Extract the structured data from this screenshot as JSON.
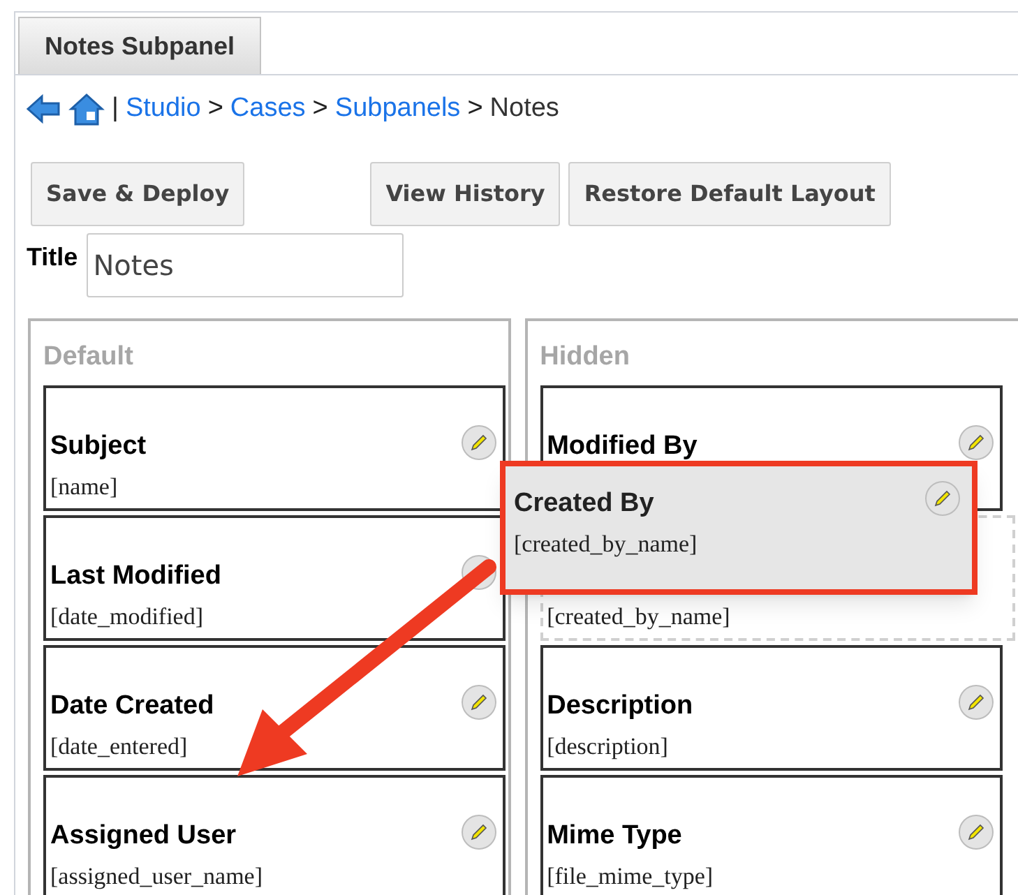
{
  "tab": {
    "label": "Notes Subpanel",
    "selected": true
  },
  "breadcrumb": {
    "pipe": "|",
    "separator": ">",
    "items": [
      {
        "text": "Studio",
        "kind": "link"
      },
      {
        "text": "Cases",
        "kind": "link"
      },
      {
        "text": "Subpanels",
        "kind": "link"
      },
      {
        "text": "Notes",
        "kind": "current"
      }
    ]
  },
  "buttons": [
    "Save & Deploy",
    "View History",
    "Restore Default Layout"
  ],
  "title_field": {
    "label": "Title",
    "value": "Notes"
  },
  "columns": [
    {
      "heading": "Default",
      "cards": [
        {
          "label": "Subject",
          "field": "[name]",
          "kind": "field"
        },
        {
          "label": "Last Modified",
          "field": "[date_modified]",
          "kind": "field"
        },
        {
          "label": "Date Created",
          "field": "[date_entered]",
          "kind": "field"
        },
        {
          "label": "Assigned User",
          "field": "[assigned_user_name]",
          "kind": "field"
        }
      ]
    },
    {
      "heading": "Hidden",
      "cards": [
        {
          "label": "Modified By",
          "kind": "field"
        },
        {
          "field": "[created_by_name]",
          "kind": "drop_placeholder"
        },
        {
          "label": "Description",
          "field": "[description]",
          "kind": "field"
        },
        {
          "label": "Mime Type",
          "field": "[file_mime_type]",
          "kind": "field"
        }
      ]
    }
  ],
  "dragged_card": {
    "label": "Created By",
    "field": "[created_by_name]"
  }
}
